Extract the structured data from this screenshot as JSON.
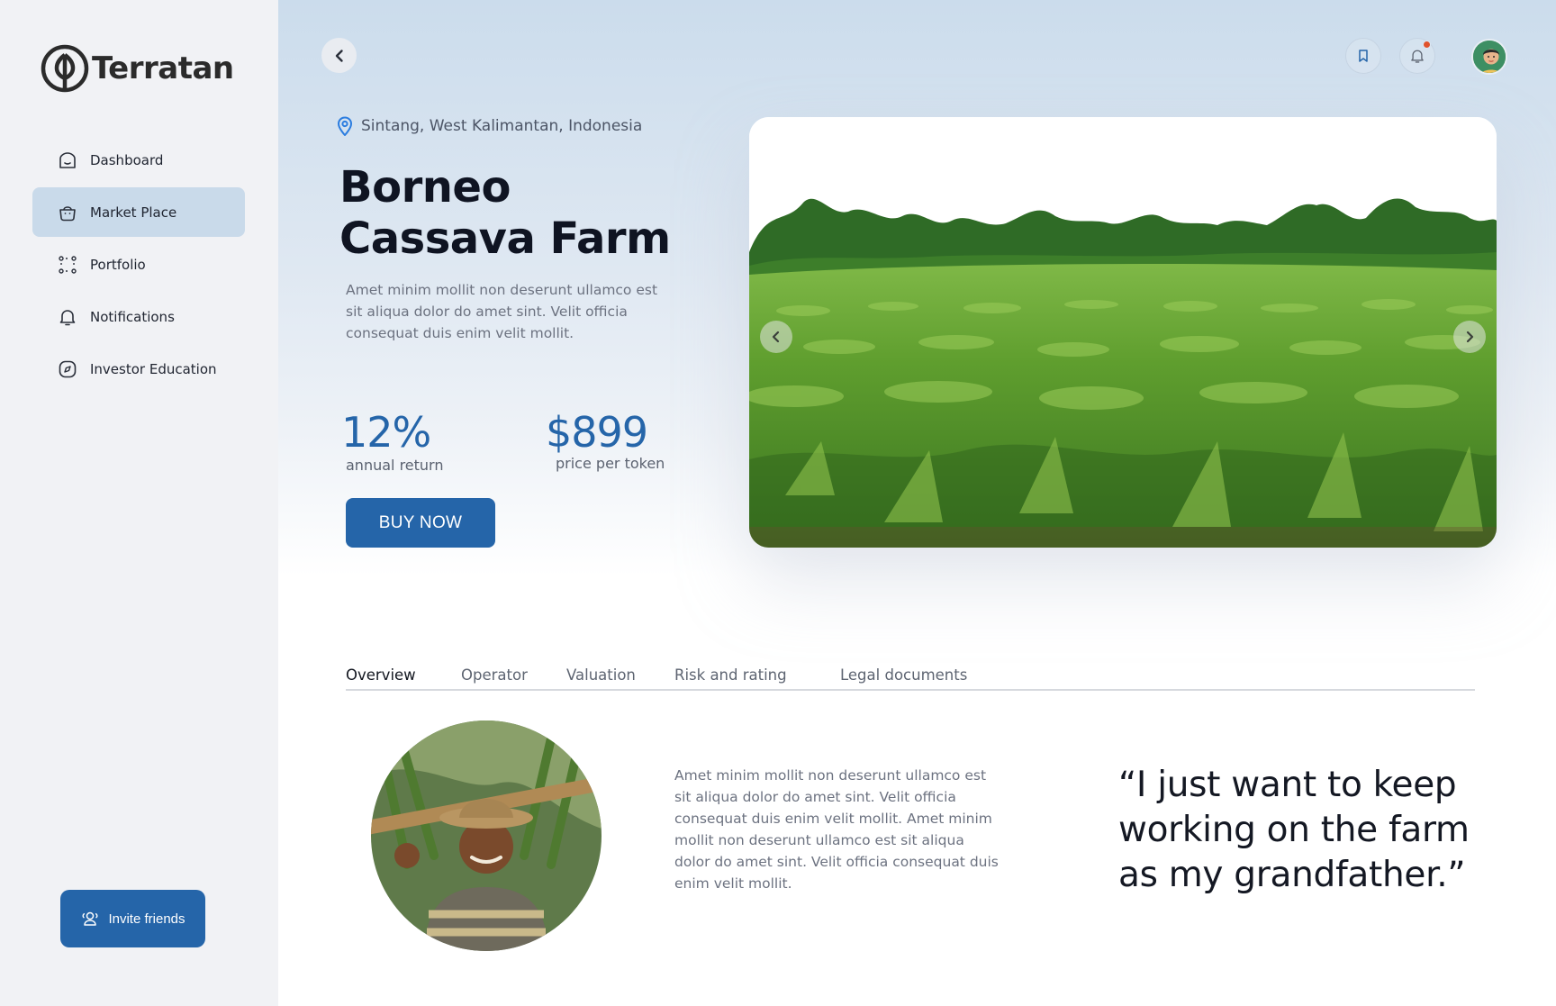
{
  "app": {
    "name": "Terratan"
  },
  "sidebar": {
    "items": [
      {
        "label": "Dashboard",
        "icon": "home-icon",
        "active": false
      },
      {
        "label": "Market Place",
        "icon": "basket-icon",
        "active": true
      },
      {
        "label": "Portfolio",
        "icon": "grid-icon",
        "active": false
      },
      {
        "label": "Notifications",
        "icon": "bell-icon",
        "active": false
      },
      {
        "label": "Investor Education",
        "icon": "compass-icon",
        "active": false
      }
    ],
    "invite_label": "Invite friends"
  },
  "header": {
    "back_icon": "chevron-left-icon",
    "bookmark_icon": "bookmark-icon",
    "bell_icon": "bell-icon",
    "has_notification": true
  },
  "farm": {
    "location": "Sintang, West Kalimantan, Indonesia",
    "title": "Borneo Cassava Farm",
    "description": "Amet minim mollit non deserunt ullamco est sit aliqua dolor do amet sint. Velit officia consequat duis enim velit mollit.",
    "annual_return_value": "12%",
    "annual_return_label": "annual return",
    "price_value": "$899",
    "price_label": "price per token",
    "buy_label": "BUY NOW"
  },
  "tabs": [
    {
      "label": "Overview",
      "active": true
    },
    {
      "label": "Operator",
      "active": false
    },
    {
      "label": "Valuation",
      "active": false
    },
    {
      "label": "Risk and rating",
      "active": false
    },
    {
      "label": "Legal documents",
      "active": false
    }
  ],
  "overview": {
    "text": "Amet minim mollit non deserunt ullamco est sit aliqua dolor do amet sint. Velit officia consequat duis enim velit mollit. Amet minim mollit non deserunt ullamco est sit aliqua dolor do amet sint. Velit officia consequat duis enim velit mollit.",
    "quote": "“I just want to keep working on the farm as my grandfather.”"
  },
  "colors": {
    "accent": "#2565a9",
    "active_nav": "#c9daea",
    "sidebar_bg": "#f1f2f5",
    "notification_dot": "#e0522b"
  }
}
